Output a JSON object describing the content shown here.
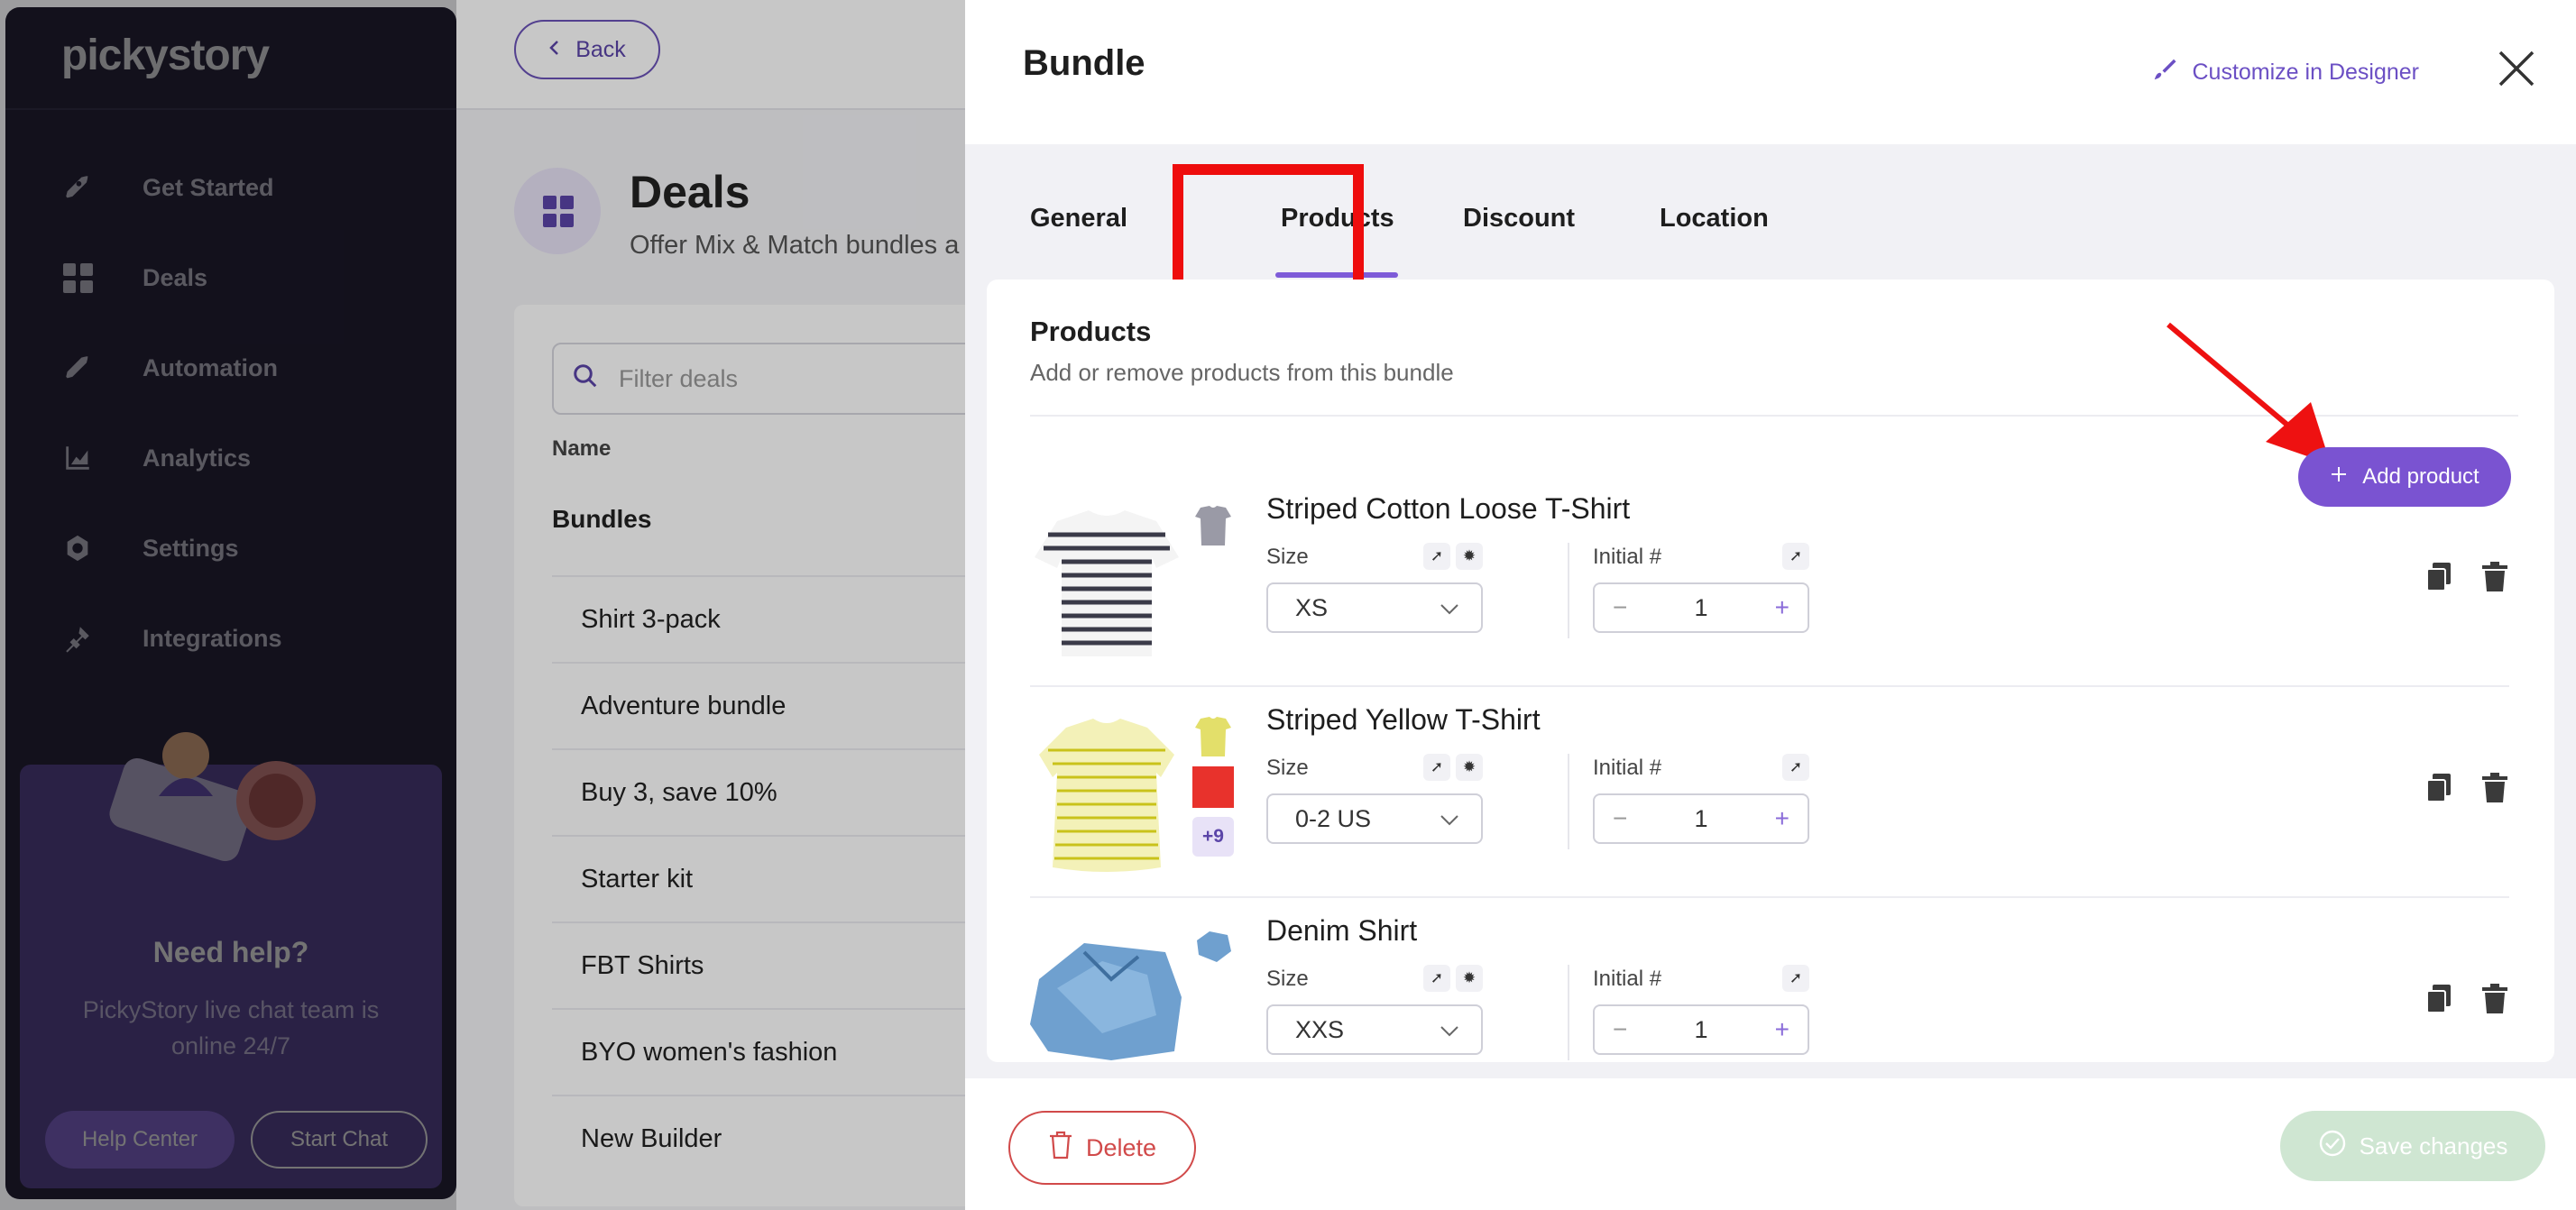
{
  "sidebar": {
    "logo": "pickystory",
    "items": [
      {
        "label": "Get Started",
        "icon": "rocket-icon"
      },
      {
        "label": "Deals",
        "icon": "grid-icon"
      },
      {
        "label": "Automation",
        "icon": "rocket-icon"
      },
      {
        "label": "Analytics",
        "icon": "chart-icon"
      },
      {
        "label": "Settings",
        "icon": "gear-icon"
      },
      {
        "label": "Integrations",
        "icon": "plug-icon"
      }
    ],
    "help": {
      "title": "Need help?",
      "subtitle": "PickyStory live chat team is online 24/7",
      "help_center": "Help Center",
      "start_chat": "Start Chat"
    }
  },
  "main": {
    "back_label": "Back",
    "title": "Deals",
    "subtitle": "Offer Mix & Match bundles a",
    "filter_placeholder": "Filter deals",
    "column_name": "Name",
    "group_label": "Bundles",
    "deals": [
      "Shirt 3-pack",
      "Adventure bundle",
      "Buy 3, save 10%",
      "Starter kit",
      "FBT Shirts",
      "BYO women's fashion",
      "New Builder"
    ]
  },
  "drawer": {
    "title": "Bundle",
    "customize_label": "Customize in Designer",
    "tabs": [
      "General",
      "Products",
      "Discount",
      "Location"
    ],
    "active_tab": "Products",
    "products_section": {
      "title": "Products",
      "subtitle": "Add or remove products from this bundle",
      "add_label": "Add product"
    },
    "labels": {
      "size": "Size",
      "initial": "Initial #"
    },
    "products": [
      {
        "name": "Striped Cotton Loose T-Shirt",
        "size": "XS",
        "initial": "1"
      },
      {
        "name": "Striped Yellow T-Shirt",
        "size": "0-2 US",
        "initial": "1",
        "more": "+9"
      },
      {
        "name": "Denim Shirt",
        "size": "XXS",
        "initial": "1"
      }
    ],
    "footer": {
      "delete_label": "Delete",
      "save_label": "Save changes"
    }
  },
  "colors": {
    "accent": "#7a53d1",
    "danger": "#d14a4a",
    "highlight": "#ee0d0d",
    "save_disabled": "#cfe6d2"
  }
}
